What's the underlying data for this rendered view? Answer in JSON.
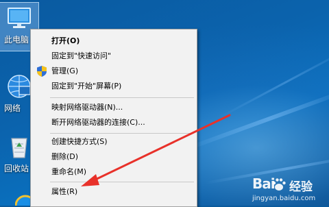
{
  "desktop": {
    "icons": [
      {
        "label": "此电脑",
        "icon": "this-pc-icon"
      },
      {
        "label": "网络",
        "icon": "network-icon"
      },
      {
        "label": "回收站",
        "icon": "recycle-bin-icon"
      }
    ]
  },
  "context_menu": {
    "items": [
      {
        "label": "打开(O)",
        "bold": true
      },
      {
        "label": "固定到\"快速访问\""
      },
      {
        "label": "管理(G)",
        "icon": "admin-shield-icon"
      },
      {
        "label": "固定到\"开始\"屏幕(P)"
      },
      {
        "label": "映射网络驱动器(N)..."
      },
      {
        "label": "断开网络驱动器的连接(C)..."
      },
      {
        "label": "创建快捷方式(S)"
      },
      {
        "label": "删除(D)"
      },
      {
        "label": "重命名(M)"
      },
      {
        "label": "属性(R)"
      }
    ]
  },
  "annotation": {
    "arrow_color": "#e8312a"
  },
  "watermark": {
    "brand": "Bai",
    "product": "经验",
    "url": "jingyan.baidu.com"
  }
}
